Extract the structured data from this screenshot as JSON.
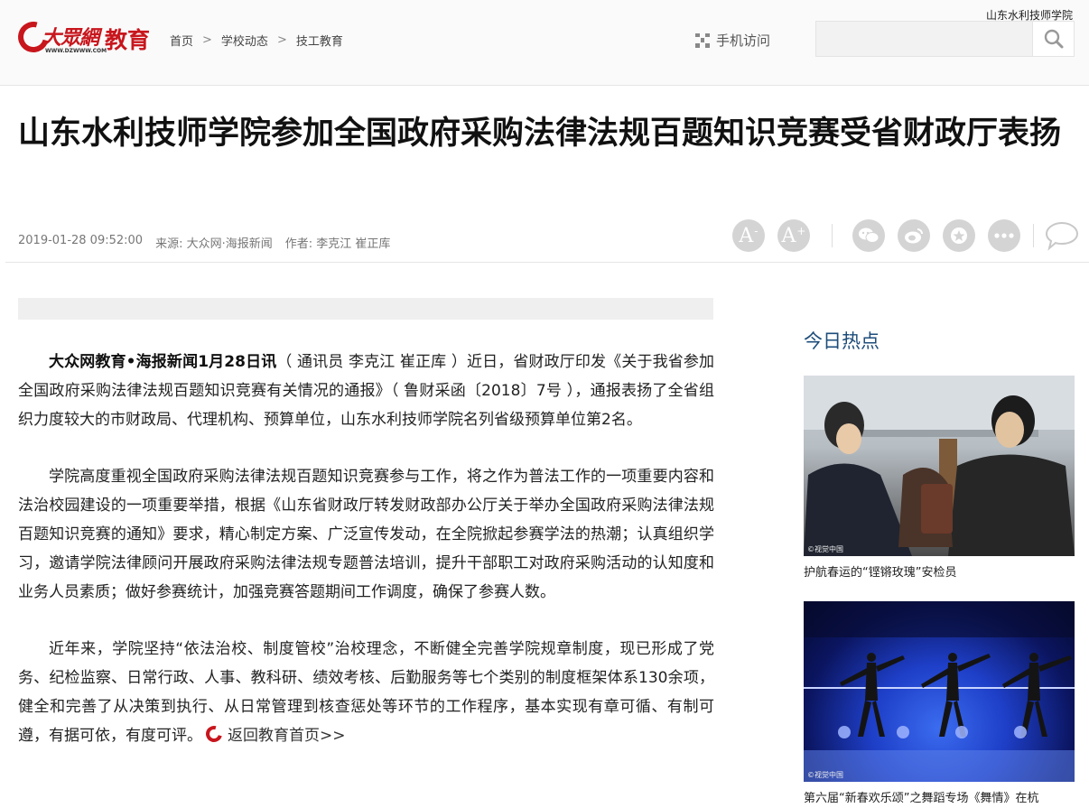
{
  "header": {
    "corner_label": "山东水利技师学院",
    "logo_text": "教育",
    "logo_brand": "大眾網",
    "logo_url": "WWW.DZWWW.COM",
    "breadcrumb": [
      "首页",
      "学校动态",
      "技工教育"
    ],
    "breadcrumb_sep": ">",
    "mobile_label": "手机访问",
    "search_placeholder": "",
    "brand_color": "#c8161d"
  },
  "article": {
    "title": "山东水利技师学院参加全国政府采购法律法规百题知识竞赛受省财政厅表扬",
    "date": "2019-01-28 09:52:00",
    "source": "来源: 大众网·海报新闻",
    "author": "作者: 李克江 崔正库",
    "tools": {
      "font_smaller": "A",
      "font_larger": "A",
      "icons": [
        "font-decrease-icon",
        "font-increase-icon",
        "wechat-icon",
        "weibo-icon",
        "favorite-icon",
        "more-icon",
        "comment-icon"
      ]
    },
    "lead_bold": "大众网教育•海报新闻1月28日讯",
    "p1_rest": "（ 通讯员 李克江 崔正库 ）近日，省财政厅印发《关于我省参加全国政府采购法律法规百题知识竞赛有关情况的通报》（ 鲁财采函〔2018〕7号 ），通报表扬了全省组织力度较大的市财政局、代理机构、预算单位，山东水利技师学院名列省级预算单位第2名。",
    "p2": "学院高度重视全国政府采购法律法规百题知识竞赛参与工作，将之作为普法工作的一项重要内容和法治校园建设的一项重要举措，根据《山东省财政厅转发财政部办公厅关于举办全国政府采购法律法规百题知识竞赛的通知》要求，精心制定方案、广泛宣传发动，在全院掀起参赛学法的热潮；认真组织学习，邀请学院法律顾问开展政府采购法律法规专题普法培训，提升干部职工对政府采购活动的认知度和业务人员素质；做好参赛统计，加强竞赛答题期间工作调度，确保了参赛人数。",
    "p3": "近年来，学院坚持“依法治校、制度管校”治校理念，不断健全完善学院规章制度，现已形成了党务、纪检监察、日常行政、人事、教科研、绩效考核、后勤服务等七个类别的制度框架体系130余项，健全和完善了从决策到执行、从日常管理到核查惩处等环节的工作程序，基本实现有章可循、有制可遵，有据可依，有度可评。",
    "back_link": "返回教育首页>>"
  },
  "sidebar": {
    "title": "今日热点",
    "items": [
      {
        "caption": "护航春运的“铿锵玫瑰”安检员",
        "watermark": "©视觉中国"
      },
      {
        "caption": "第六届“新春欢乐颂”之舞蹈专场《舞情》在杭",
        "watermark": "©视觉中国"
      }
    ]
  }
}
